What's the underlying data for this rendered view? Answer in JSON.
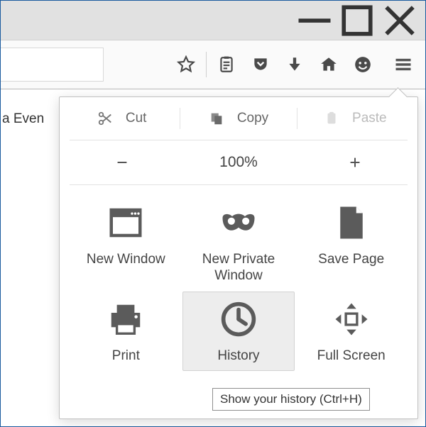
{
  "window_controls": {
    "minimize": "minimize",
    "maximize": "maximize",
    "close": "close"
  },
  "toolbar_icons": {
    "star": "bookmark-star",
    "clipboard": "reading-list",
    "pocket": "pocket",
    "download": "downloads",
    "home": "home",
    "smiley": "feedback",
    "menu": "menu"
  },
  "page_visible_text": "a Even",
  "menu": {
    "edit": {
      "cut": "Cut",
      "copy": "Copy",
      "paste": "Paste"
    },
    "zoom": {
      "out": "−",
      "level": "100%",
      "in": "+"
    },
    "grid": [
      {
        "id": "new-window",
        "label": "New Window"
      },
      {
        "id": "new-private-window",
        "label": "New Private Window"
      },
      {
        "id": "save-page",
        "label": "Save Page"
      },
      {
        "id": "print",
        "label": "Print"
      },
      {
        "id": "history",
        "label": "History"
      },
      {
        "id": "full-screen",
        "label": "Full Screen"
      }
    ]
  },
  "tooltip": "Show your history (Ctrl+H)",
  "colors": {
    "icon": "#5b5b5b",
    "border": "#c0c0c0",
    "titlebar": "#e1e1e1",
    "hover": "#ededed"
  }
}
